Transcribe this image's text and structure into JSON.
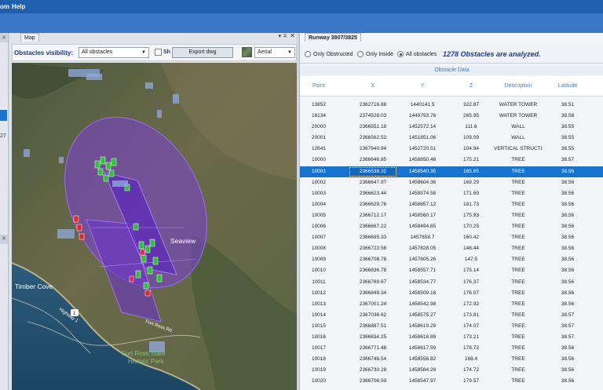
{
  "menubar": {
    "items": [
      "om",
      "Help"
    ]
  },
  "left_strip": {
    "partial_text": "27"
  },
  "map_panel": {
    "tab_title": "Map",
    "pin_glyph": "▾ ∓",
    "close_glyph": "✕",
    "visibility_label": "Obstacles visibility:",
    "visibility_value": "All obstacles",
    "show_label_partial": "Sh",
    "export_button": "Export dwg",
    "basemap_value": "Aerial",
    "labels": {
      "seaview": "Seaview",
      "timber_cove": "Timber Cove",
      "highway": "Highway 1",
      "shield": "1",
      "fort_ross_rd": "Fort Ross Rd",
      "fort_ross_park_1": "Fort Ross State",
      "fort_ross_park_2": "Historic Park"
    }
  },
  "right_panel": {
    "tab_title": "Runway 3807/3825",
    "filters": {
      "only_obstructed": "Only Obstructed",
      "only_inside": "Only Inside",
      "all_obstacles": "All obstacles",
      "selected": "all_obstacles"
    },
    "analyzed_text": "1278 Obstacles are analyzed.",
    "group_title": "Obstacle Data",
    "columns": [
      "Point",
      "X",
      "Y",
      "Z",
      "Description",
      "Latitude"
    ],
    "selected_row": 6,
    "rows": [
      [
        "13852",
        "2362716.88",
        "1440141.5",
        "322.87",
        "WATER TOWER",
        "38.51"
      ],
      [
        "16134",
        "2374528.03",
        "1449793.76",
        "265.95",
        "WATER TOWER",
        "38.58"
      ],
      [
        "20000",
        "2366551.19",
        "1452572.14",
        "111.6",
        "WALL",
        "38.55"
      ],
      [
        "20001",
        "2366562.52",
        "1451851.06",
        "109.09",
        "WALL",
        "38.55"
      ],
      [
        "12641",
        "2367940.94",
        "1452720.51",
        "104.94",
        "VERTICAL STRUCTU",
        "38.55"
      ],
      [
        "10000",
        "2366646.85",
        "1458850.48",
        "175.21",
        "TREE",
        "38.57"
      ],
      [
        "10001",
        "2366538.32",
        "1458540.35",
        "165.85",
        "TREE",
        "38.56"
      ],
      [
        "10002",
        "2366647.97",
        "1458604.36",
        "169.29",
        "TREE",
        "38.56"
      ],
      [
        "10003",
        "2366623.44",
        "1458574.58",
        "171.69",
        "TREE",
        "38.56"
      ],
      [
        "10004",
        "2366629.76",
        "1458657.12",
        "181.73",
        "TREE",
        "38.56"
      ],
      [
        "10005",
        "2366712.17",
        "1458560.17",
        "175.93",
        "TREE",
        "38.56"
      ],
      [
        "10006",
        "2366667.22",
        "1458494.65",
        "170.25",
        "TREE",
        "38.56"
      ],
      [
        "10007",
        "2366695.33",
        "1457858.7",
        "160.42",
        "TREE",
        "38.56"
      ],
      [
        "10008",
        "2366722.58",
        "1457828.05",
        "148.44",
        "TREE",
        "38.56"
      ],
      [
        "10009",
        "2366708.78",
        "1457805.26",
        "147.5",
        "TREE",
        "38.56"
      ],
      [
        "10010",
        "2366836.78",
        "1458557.71",
        "175.14",
        "TREE",
        "38.56"
      ],
      [
        "10011",
        "2366769.67",
        "1458534.77",
        "176.37",
        "TREE",
        "38.56"
      ],
      [
        "10012",
        "2366849.34",
        "1458509.18",
        "176.07",
        "TREE",
        "38.56"
      ],
      [
        "10013",
        "2367001.24",
        "1458542.98",
        "172.92",
        "TREE",
        "38.56"
      ],
      [
        "10014",
        "2367038.62",
        "1458575.27",
        "173.81",
        "TREE",
        "38.57"
      ],
      [
        "10015",
        "2366887.51",
        "1458619.29",
        "174.07",
        "TREE",
        "38.57"
      ],
      [
        "10016",
        "2366834.25",
        "1458618.89",
        "173.21",
        "TREE",
        "38.57"
      ],
      [
        "10017",
        "2366771.48",
        "1458617.59",
        "178.72",
        "TREE",
        "38.56"
      ],
      [
        "10018",
        "2366746.54",
        "1458556.82",
        "168.4",
        "TREE",
        "38.56"
      ],
      [
        "10019",
        "2366730.28",
        "1458584.28",
        "174.72",
        "TREE",
        "38.56"
      ],
      [
        "10020",
        "2366706.59",
        "1458547.97",
        "179.57",
        "TREE",
        "38.56"
      ]
    ]
  },
  "colors": {
    "menubar": "#1f5fae",
    "accent": "#1d3b8f",
    "selection": "#1773cd",
    "zone": "#7b3fd6"
  }
}
